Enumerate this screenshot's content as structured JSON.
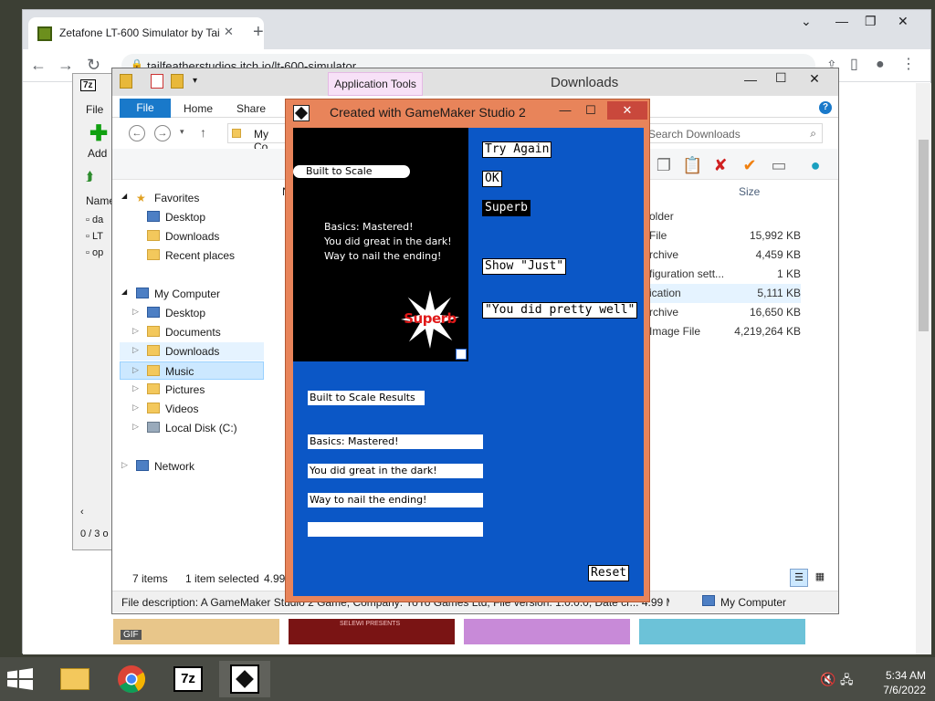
{
  "browser": {
    "tab_title": "Zetafone LT-600 Simulator by Tai",
    "tab_close": "✕",
    "new_tab": "+",
    "url": "tailfeatherstudios.itch.io/lt-600-simulator",
    "thumbnail_gif_badge": "GIF",
    "thumbnail_banner": "SELEWI PRESENTS"
  },
  "zip": {
    "title_badge": "7z",
    "menu_file": "File",
    "add_label": "Add",
    "col_name": "Name",
    "rows": [
      "da",
      "LT",
      "op"
    ],
    "status": "0 / 3 o"
  },
  "explorer": {
    "app_tools": "Application Tools",
    "title": "Downloads",
    "tabs": [
      "File",
      "Home",
      "Share"
    ],
    "address_partial": "My Co",
    "search_placeholder": "Search Downloads",
    "column_name_partial": "N",
    "column_size": "Size",
    "nav": {
      "favorites": "Favorites",
      "fav_items": [
        "Desktop",
        "Downloads",
        "Recent places"
      ],
      "computer": "My Computer",
      "computer_items": [
        "Desktop",
        "Documents",
        "Downloads",
        "Music",
        "Pictures",
        "Videos",
        "Local Disk (C:)"
      ],
      "network": "Network"
    },
    "rows": [
      {
        "type": "older",
        "size": ""
      },
      {
        "type": "File",
        "size": "15,992 KB"
      },
      {
        "type": "rchive",
        "size": "4,459 KB"
      },
      {
        "type": "figuration sett...",
        "size": "1 KB"
      },
      {
        "type": "ication",
        "size": "5,111 KB"
      },
      {
        "type": "rchive",
        "size": "16,650 KB"
      },
      {
        "type": "Image File",
        "size": "4,219,264 KB"
      }
    ],
    "status_items": "7 items",
    "status_selected": "1 item selected",
    "status_size": "4.99",
    "description": "File description: A GameMaker Studio 2 Game, Company: YoYo Games Ltd, File version: 1.0.0.0, Date cr... 4.99 MB",
    "description_right": "My Computer"
  },
  "gamemaker": {
    "title": "Created with GameMaker Studio 2",
    "min": "—",
    "max": "☐",
    "close": "✕",
    "screen_pill": "Built to Scale Results",
    "screen_lines": [
      "Basics: Mastered!",
      "You did great in the dark!",
      "Way to nail the ending!"
    ],
    "burst_text": "Superb",
    "buttons": {
      "try_again": "Try Again",
      "ok": "OK",
      "superb": "Superb",
      "show_just": "Show \"Just\"",
      "pretty_well": "\"You did pretty well\"",
      "reset": "Reset"
    },
    "fields": [
      "Built to Scale Results",
      "Basics: Mastered!",
      "You did great in the dark!",
      "Way to nail the ending!",
      ""
    ]
  },
  "taskbar": {
    "zip_label": "7z",
    "time": "5:34 AM",
    "date": "7/6/2022"
  },
  "colors": {
    "gm_blue": "#0b57c6",
    "gm_frame": "#e8845a",
    "explorer_accent": "#1979ca"
  }
}
